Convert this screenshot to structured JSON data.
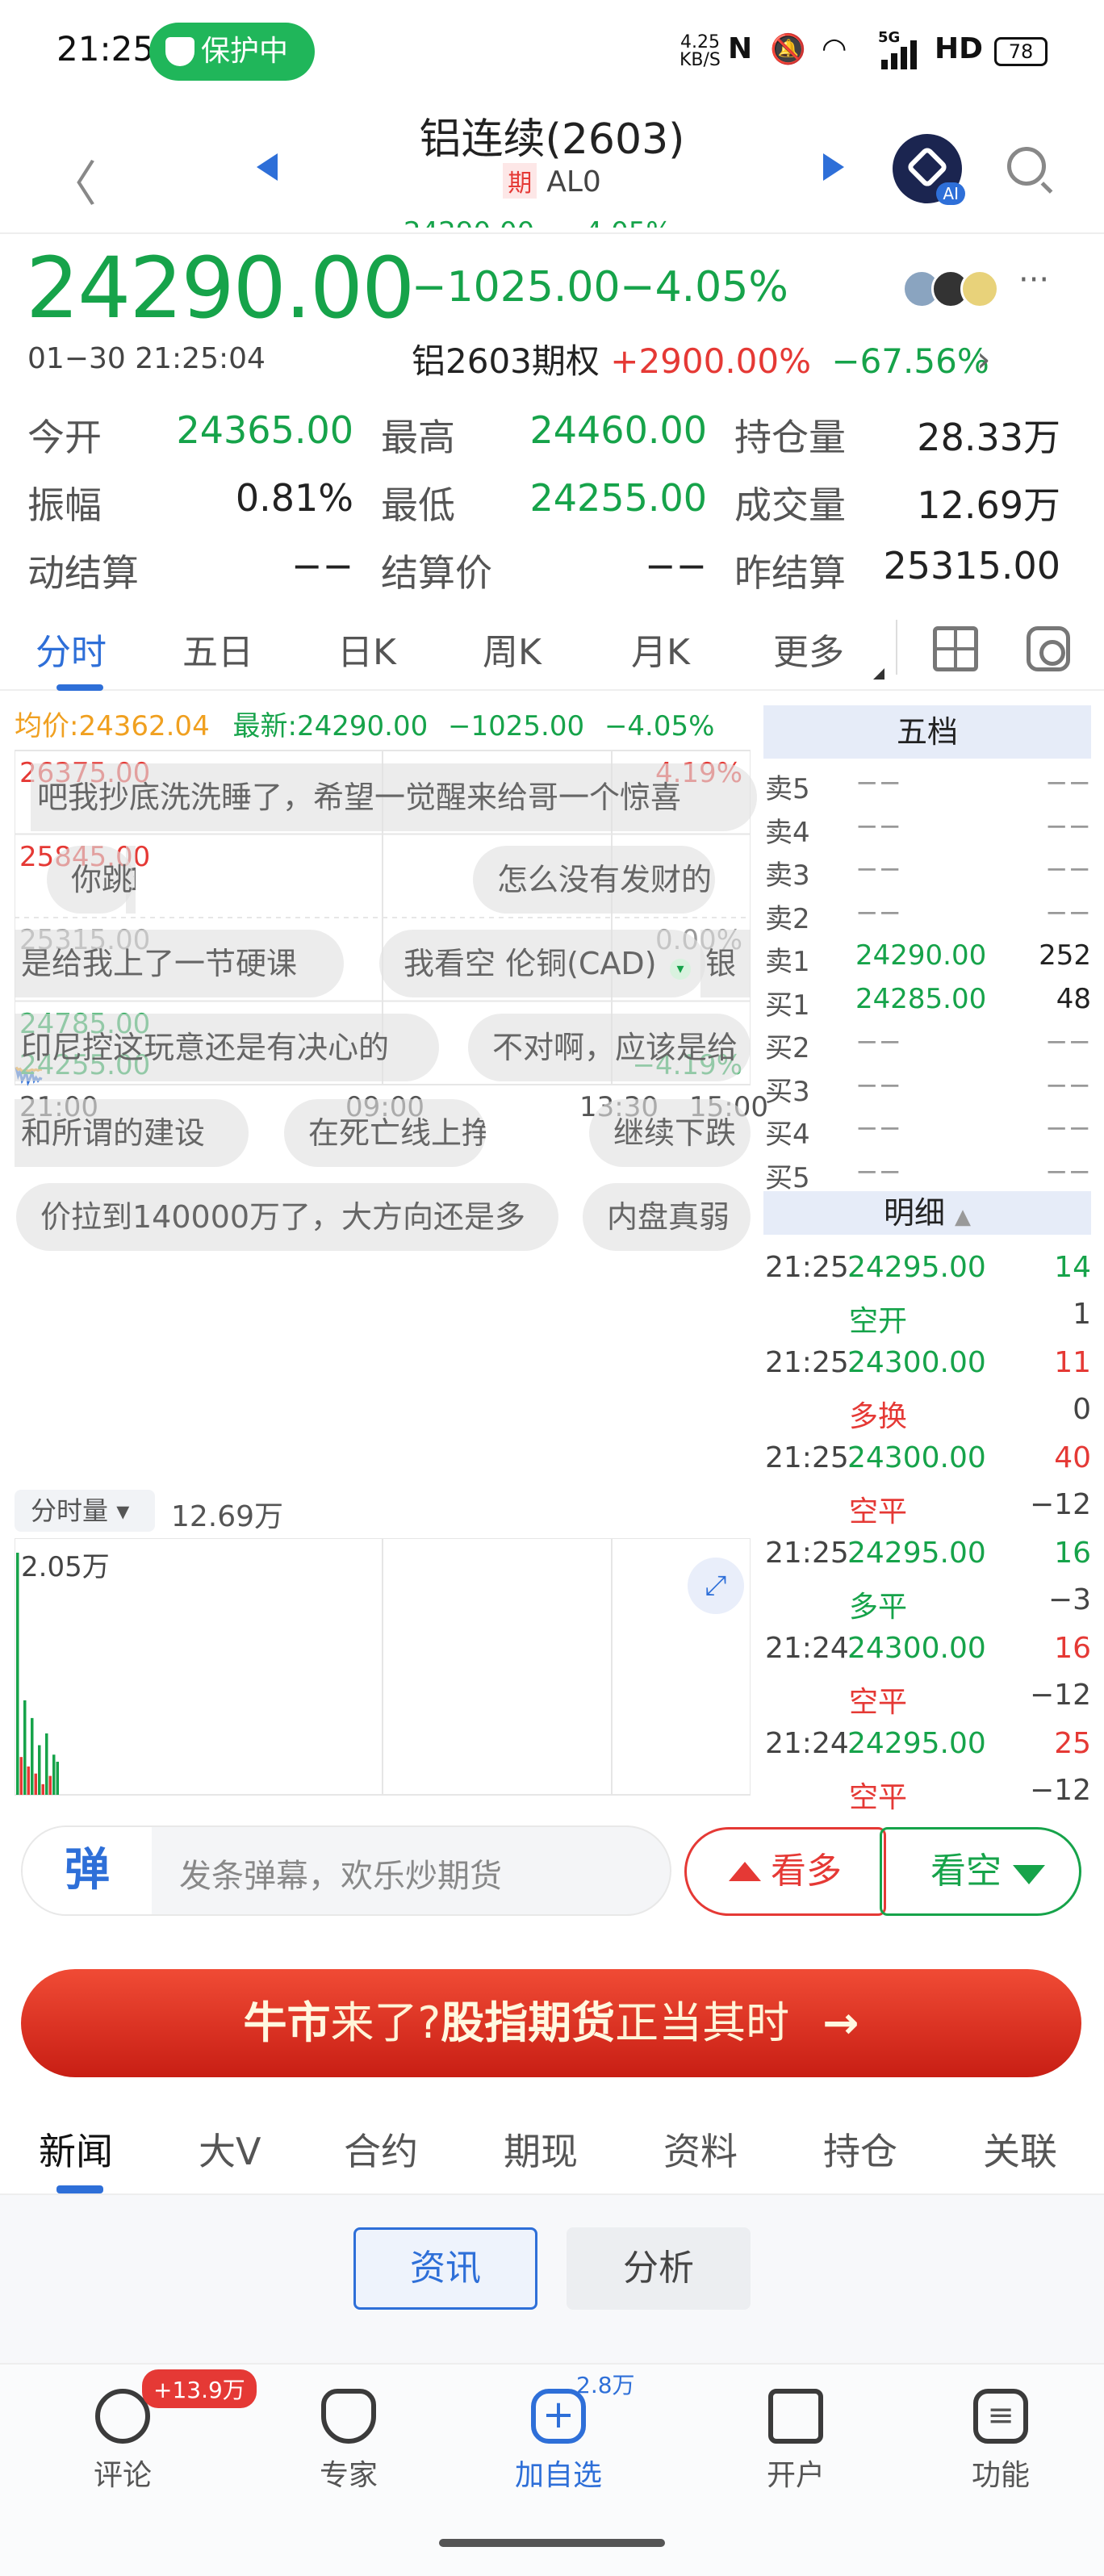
{
  "status_bar": {
    "time": "21:25",
    "protect_label": "保护中",
    "net_speed_value": "4.25",
    "net_speed_unit": "KB/S",
    "nfc_label": "N",
    "network": "5G",
    "hd": "HD",
    "battery": "78"
  },
  "header": {
    "title": "铝连续(2603)",
    "tag": "期",
    "code": "AL0",
    "ghost_text": "24290.00　−4.05%",
    "ai_label": "AI"
  },
  "quote": {
    "price": "24290.00",
    "change": "−1025.00",
    "change_pct": "−4.05%",
    "datetime": "01−30 21:25:04",
    "option_label": "铝2603期权",
    "option_up": "+2900.00%",
    "option_down": "−67.56%",
    "more": "···"
  },
  "stats": [
    {
      "label": "今开",
      "value": "24365.00",
      "color": "green"
    },
    {
      "label": "最高",
      "value": "24460.00",
      "color": "green"
    },
    {
      "label": "持仓量",
      "value": "28.33万",
      "color": "black"
    },
    {
      "label": "振幅",
      "value": "0.81%",
      "color": "black"
    },
    {
      "label": "最低",
      "value": "24255.00",
      "color": "green"
    },
    {
      "label": "成交量",
      "value": "12.69万",
      "color": "black"
    },
    {
      "label": "动结算",
      "value": "−−",
      "color": "black"
    },
    {
      "label": "结算价",
      "value": "−−",
      "color": "black"
    },
    {
      "label": "昨结算",
      "value": "25315.00",
      "color": "black"
    }
  ],
  "tabs": [
    "分时",
    "五日",
    "日K",
    "周K",
    "月K",
    "更多"
  ],
  "chart_info": {
    "avg_label": "均价:",
    "avg_value": "24362.04",
    "latest_label": "最新:",
    "latest_value": "24290.00",
    "latest_change": "−1025.00",
    "latest_pct": "−4.05%",
    "vol_select": "分时量",
    "vol_total": "12.69万",
    "vol_max": "2.05万"
  },
  "chart_data": {
    "type": "line",
    "y_labels_left": [
      "26375.00",
      "25845.00",
      "25315.00",
      "24785.00",
      "24255.00"
    ],
    "y_labels_right": [
      "4.19%",
      "",
      "0.00%",
      "",
      "−4.19%"
    ],
    "x_labels": [
      "21:00",
      "09:00",
      "13:30",
      "15:00"
    ],
    "ylim": [
      24255.0,
      26375.0
    ],
    "series": [
      {
        "name": "最新",
        "x": [
          0,
          1,
          2,
          3,
          4,
          5,
          6,
          7,
          8,
          9,
          10,
          11,
          12,
          13
        ],
        "values": [
          24365,
          24310,
          24340,
          24280,
          24300,
          24340,
          24270,
          24295,
          24330,
          24280,
          24300,
          24280,
          24295,
          24290
        ],
        "color": "#2e6fd8"
      },
      {
        "name": "均价",
        "x": [
          0,
          1,
          2,
          3,
          4,
          5,
          6,
          7,
          8,
          9,
          10,
          11,
          12,
          13
        ],
        "values": [
          24365,
          24350,
          24355,
          24340,
          24345,
          24350,
          24340,
          24345,
          24350,
          24345,
          24350,
          24345,
          24350,
          24350
        ],
        "color": "#f0a020"
      }
    ],
    "volume": {
      "max_label": "2.05万",
      "values": [
        20500,
        3200,
        8000,
        2400,
        6500,
        1800,
        4200,
        900,
        5200,
        1600,
        3400,
        2800
      ],
      "colors": [
        "#16a34a",
        "#e53935",
        "#16a34a",
        "#e53935",
        "#16a34a",
        "#e53935",
        "#16a34a",
        "#e53935",
        "#16a34a",
        "#e53935",
        "#16a34a",
        "#16a34a"
      ]
    }
  },
  "danmaku": [
    "吧我抄底洗洗睡了，希望一觉醒来给哥一个惊喜",
    "1",
    "你跳个锤子？你涨了吗？",
    "怎么没有发财的",
    "是给我上了一节硬课",
    "我看空 伦铜(CAD)",
    "银",
    "印尼控这玩意还是有决心的",
    "不对啊，应该是给",
    "和所谓的建设",
    "在死亡线上挣扎",
    "继续下跌",
    "价拉到140000万了，大方向还是多",
    "内盘真弱"
  ],
  "order_book": {
    "title": "五档",
    "asks": [
      {
        "label": "卖5",
        "price": "−−",
        "qty": "−−"
      },
      {
        "label": "卖4",
        "price": "−−",
        "qty": "−−"
      },
      {
        "label": "卖3",
        "price": "−−",
        "qty": "−−"
      },
      {
        "label": "卖2",
        "price": "−−",
        "qty": "−−"
      },
      {
        "label": "卖1",
        "price": "24290.00",
        "qty": "252"
      }
    ],
    "bids": [
      {
        "label": "买1",
        "price": "24285.00",
        "qty": "48"
      },
      {
        "label": "买2",
        "price": "−−",
        "qty": "−−"
      },
      {
        "label": "买3",
        "price": "−−",
        "qty": "−−"
      },
      {
        "label": "买4",
        "price": "−−",
        "qty": "−−"
      },
      {
        "label": "买5",
        "price": "−−",
        "qty": "−−"
      }
    ],
    "detail_title": "明细",
    "details": [
      {
        "time": "21:25",
        "price": "24295.00",
        "qty": "14",
        "qty_color": "green",
        "type": "空开",
        "type_color": "green",
        "delta": "1"
      },
      {
        "time": "21:25",
        "price": "24300.00",
        "qty": "11",
        "qty_color": "red",
        "type": "多换",
        "type_color": "red",
        "delta": "0"
      },
      {
        "time": "21:25",
        "price": "24300.00",
        "qty": "40",
        "qty_color": "red",
        "type": "空平",
        "type_color": "red",
        "delta": "−12"
      },
      {
        "time": "21:25",
        "price": "24295.00",
        "qty": "16",
        "qty_color": "green",
        "type": "多平",
        "type_color": "green",
        "delta": "−3"
      },
      {
        "time": "21:24",
        "price": "24300.00",
        "qty": "16",
        "qty_color": "red",
        "type": "空平",
        "type_color": "red",
        "delta": "−12"
      },
      {
        "time": "21:24",
        "price": "24295.00",
        "qty": "25",
        "qty_color": "red",
        "type": "空平",
        "type_color": "red",
        "delta": "−12"
      }
    ]
  },
  "comment_bar": {
    "danmaku_btn": "弹",
    "placeholder": "发条弹幕，欢乐炒期货",
    "bull": "看多",
    "bear": "看空"
  },
  "banner": {
    "part1": "牛市",
    "part2": "来了?",
    "part3": "股指期货",
    "part4": "正当其时",
    "arrow": "→"
  },
  "news_tabs": [
    "新闻",
    "大V",
    "合约",
    "期现",
    "资料",
    "持仓",
    "关联"
  ],
  "news_segments": [
    "资讯",
    "分析"
  ],
  "bottom_nav": [
    {
      "label": "评论",
      "icon": "comment-icon"
    },
    {
      "label": "专家",
      "icon": "expert-icon"
    },
    {
      "label": "加自选",
      "icon": "add-watch-icon"
    },
    {
      "label": "开户",
      "icon": "open-account-icon"
    },
    {
      "label": "功能",
      "icon": "menu-icon"
    }
  ],
  "badges": {
    "comment": "+13.9万",
    "add_watch": "2.8万"
  }
}
